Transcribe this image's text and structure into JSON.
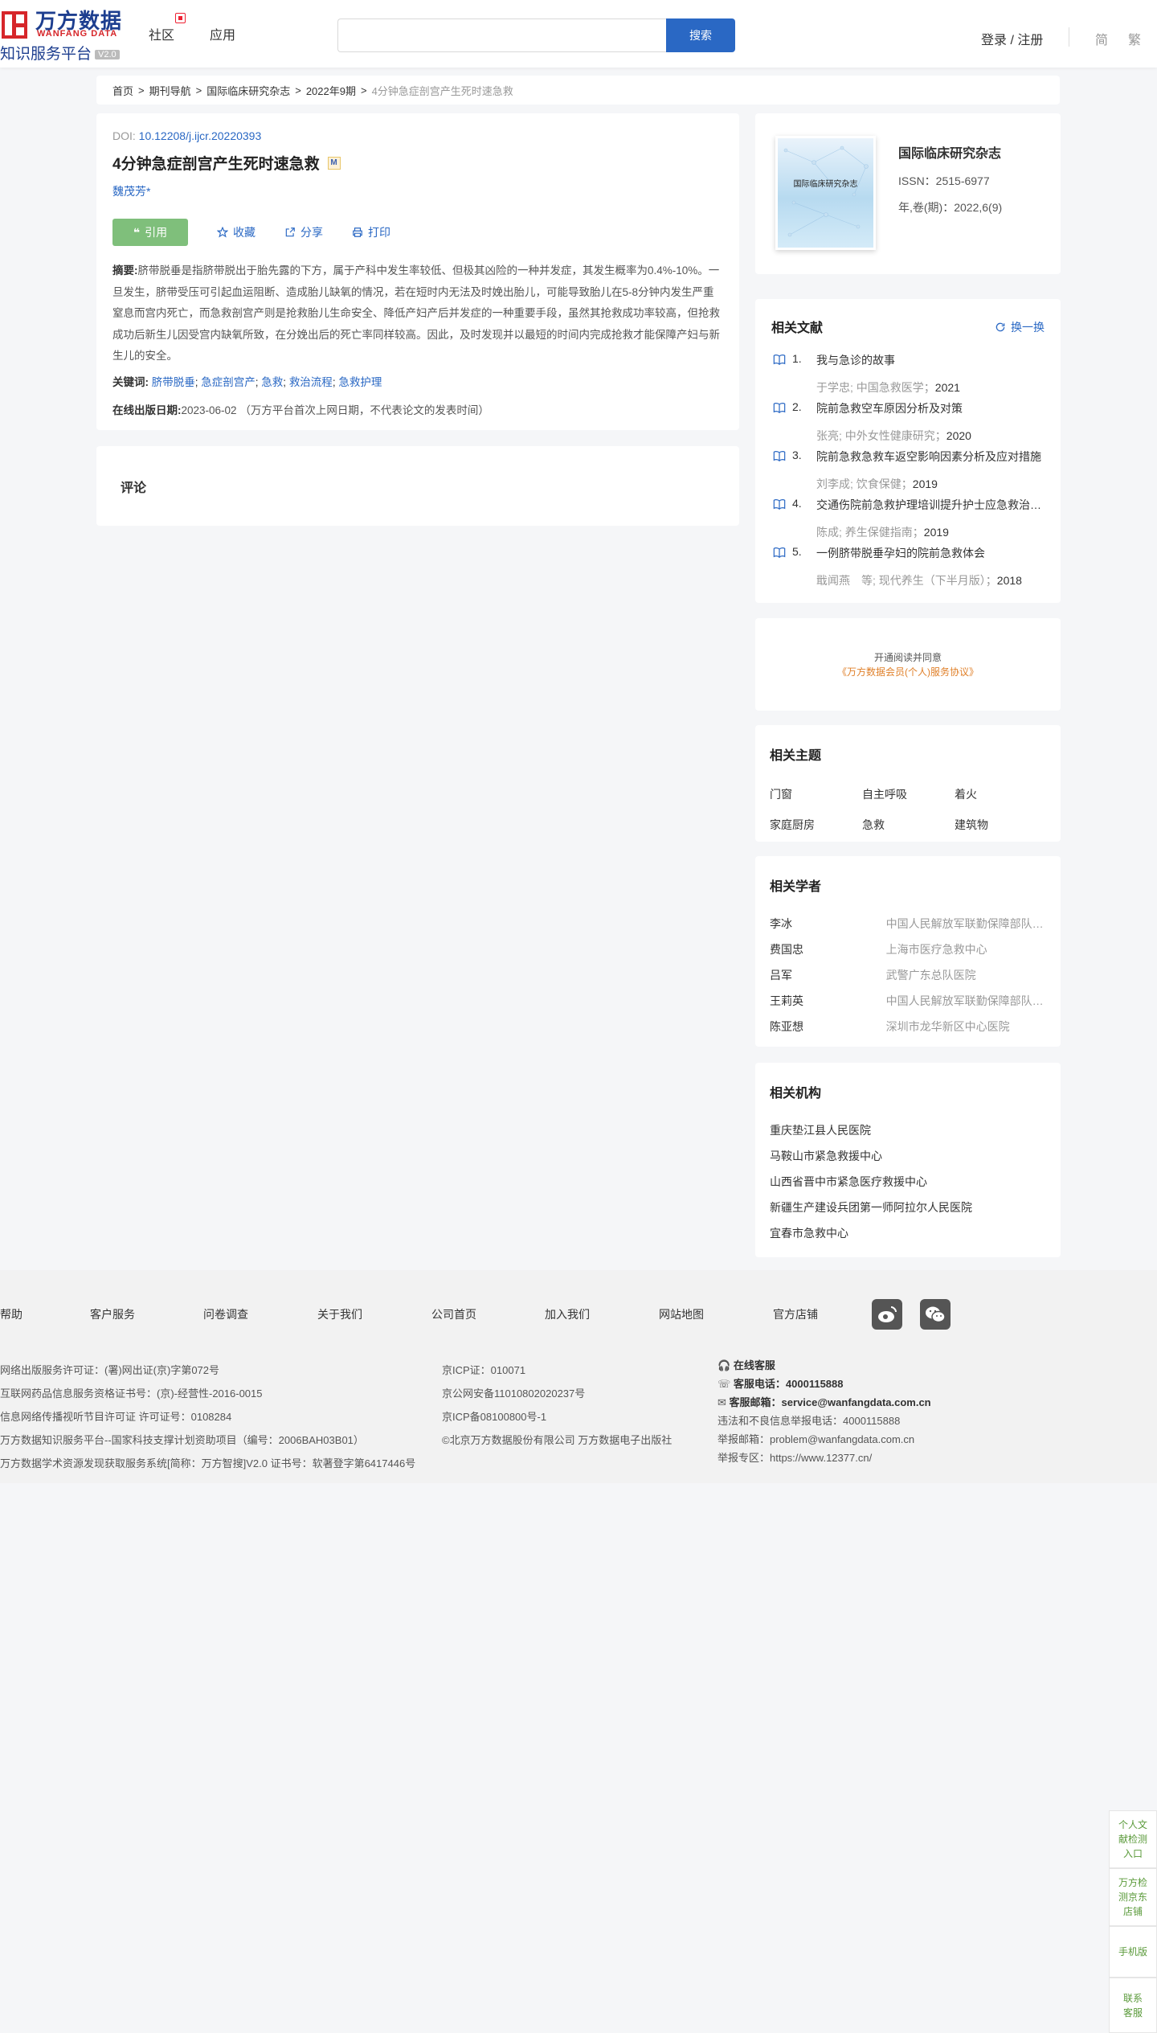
{
  "header": {
    "logo_cn": "万方数据",
    "logo_en": "WANFANG DATA",
    "logo_sub": "知识服务平台",
    "logo_ver": "V2.0",
    "nav": [
      "社区",
      "应用"
    ],
    "search_placeholder": "",
    "search_button": "搜索",
    "login": "登录 / 注册",
    "lang_simplified": "简",
    "lang_traditional": "繁"
  },
  "breadcrumb": {
    "items": [
      "首页",
      "期刊导航",
      "国际临床研究杂志",
      "2022年9期"
    ],
    "current": "4分钟急症剖宫产生死时速急救"
  },
  "article": {
    "doi_label": "DOI:",
    "doi": "10.12208/j.ijcr.20220393",
    "title": "4分钟急症剖宫产生死时速急救",
    "title_badge": "M",
    "author": "魏茂芳*",
    "actions": {
      "cite": "引用",
      "favorite": "收藏",
      "share": "分享",
      "print": "打印"
    },
    "abstract_label": "摘要:",
    "abstract": "脐带脱垂是指脐带脱出于胎先露的下方，属于产科中发生率较低、但极其凶险的一种并发症，其发生概率为0.4%-10%。一旦发生，脐带受压可引起血运阻断、造成胎儿缺氧的情况，若在短时内无法及时娩出胎儿，可能导致胎儿在5-8分钟内发生严重窒息而宫内死亡，而急救剖宫产则是抢救胎儿生命安全、降低产妇产后并发症的一种重要手段，虽然其抢救成功率较高，但抢救成功后新生儿因受宫内缺氧所致，在分娩出后的死亡率同样较高。因此，及时发现并以最短的时间内完成抢救才能保障产妇与新生儿的安全。",
    "keywords_label": "关键词:",
    "keywords": [
      "脐带脱垂",
      "急症剖宫产",
      "急救",
      "救治流程",
      "急救护理"
    ],
    "pubdate_label": "在线出版日期:",
    "pubdate": "2023-06-02",
    "pubdate_note": "（万方平台首次上网日期，不代表论文的发表时间）"
  },
  "comment": {
    "title": "评论"
  },
  "journal": {
    "cover_title": "国际临床研究杂志",
    "name": "国际临床研究杂志",
    "issn": "ISSN：2515-6977",
    "volume": "年,卷(期)：2022,6(9)"
  },
  "related": {
    "title": "相关文献",
    "swap": "换一换",
    "items": [
      {
        "no": "1.",
        "title": "我与急诊的故事",
        "meta": "于学忠; 中国急救医学；",
        "year": "2021"
      },
      {
        "no": "2.",
        "title": "院前急救空车原因分析及对策",
        "meta": "张亮; 中外女性健康研究；",
        "year": "2020"
      },
      {
        "no": "3.",
        "title": "院前急救急救车返空影响因素分析及应对措施",
        "meta": "刘李成; 饮食保健；",
        "year": "2019"
      },
      {
        "no": "4.",
        "title": "交通伤院前急救护理培训提升护士应急救治能力",
        "meta": "陈成; 养生保健指南；",
        "year": "2019"
      },
      {
        "no": "5.",
        "title": "一例脐带脱垂孕妇的院前急救体会",
        "meta": "戢闻燕　等; 现代养生（下半月版）；",
        "year": "2018"
      }
    ]
  },
  "agreement": {
    "line1": "开通阅读并同意",
    "link": "《万方数据会员(个人)服务协议》"
  },
  "topics": {
    "title": "相关主题",
    "items": [
      "门窗",
      "自主呼吸",
      "着火",
      "家庭厨房",
      "急救",
      "建筑物"
    ]
  },
  "scholars": {
    "title": "相关学者",
    "items": [
      {
        "name": "李冰",
        "org": "中国人民解放军联勤保障部队第九二〇医院"
      },
      {
        "name": "费国忠",
        "org": "上海市医疗急救中心"
      },
      {
        "name": "吕军",
        "org": "武警广东总队医院"
      },
      {
        "name": "王莉英",
        "org": "中国人民解放军联勤保障部队第九六〇医院"
      },
      {
        "name": "陈亚想",
        "org": "深圳市龙华新区中心医院"
      }
    ]
  },
  "orgs": {
    "title": "相关机构",
    "items": [
      "重庆垫江县人民医院",
      "马鞍山市紧急救援中心",
      "山西省晋中市紧急医疗救援中心",
      "新疆生产建设兵团第一师阿拉尔人民医院",
      "宜春市急救中心"
    ]
  },
  "footer": {
    "links": [
      "帮助",
      "客户服务",
      "问卷调查",
      "关于我们",
      "公司首页",
      "加入我们",
      "网站地图",
      "官方店铺"
    ],
    "col1": [
      "网络出版服务许可证：(署)网出证(京)字第072号",
      "互联网药品信息服务资格证书号：(京)-经营性-2016-0015",
      "信息网络传播视听节目许可证 许可证号：0108284",
      "万方数据知识服务平台--国家科技支撑计划资助项目（编号：2006BAH03B01）",
      "万方数据学术资源发现获取服务系统[简称：万方智搜]V2.0 证书号：软著登字第6417446号"
    ],
    "col2": [
      "京ICP证：010071",
      "京公网安备11010802020237号",
      "京ICP备08100800号-1",
      "©北京万方数据股份有限公司 万方数据电子出版社"
    ],
    "col3_online": "在线客服",
    "col3_phone_label": "客服电话：",
    "col3_phone": "4000115888",
    "col3_email_label": "客服邮箱：",
    "col3_email": "service@wanfangdata.com.cn",
    "col3_report_phone": "违法和不良信息举报电话：4000115888",
    "col3_report_email": "举报邮箱：problem@wanfangdata.com.cn",
    "col3_report_site": "举报专区：https://www.12377.cn/"
  },
  "float": {
    "a": "个人文献检测入口",
    "b": "万方检测京东店铺",
    "c": "手机版",
    "d": "联系客服"
  }
}
